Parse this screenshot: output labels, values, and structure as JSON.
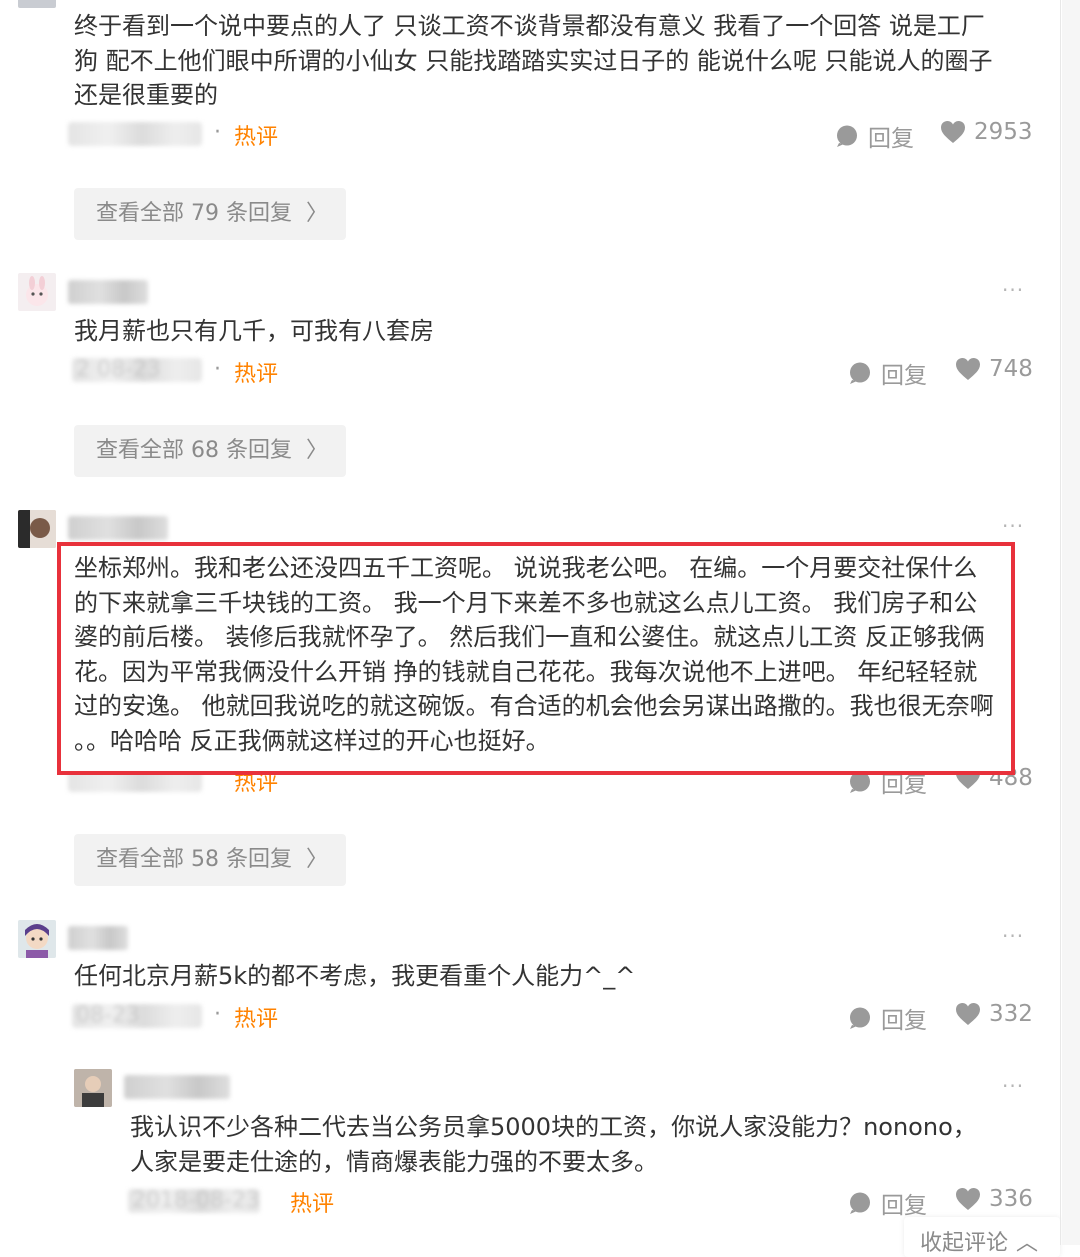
{
  "comments": [
    {
      "lines": [
        "终于看到一个说中要点的人了 只谈工资不谈背景都没有意义 我看了一个回答 说是工厂",
        "狗 配不上他们眼中所谓的小仙女 只能找踏踏实实过日子的 能说什么呢 只能说人的圈子",
        "还是很重要的"
      ],
      "meta_dot": "·",
      "hot_label": "热评",
      "reply_label": "回复",
      "likes": "2953",
      "view_all": "查看全部 79 条回复"
    },
    {
      "lines": [
        "我月薪也只有几千，可我有八套房"
      ],
      "date_partial": "2  08-23",
      "meta_dot": "·",
      "hot_label": "热评",
      "reply_label": "回复",
      "likes": "748",
      "view_all": "查看全部 68 条回复",
      "more": "···"
    },
    {
      "lines": [
        "坐标郑州。我和老公还没四五千工资呢。 说说我老公吧。 在编。一个月要交社保什么",
        "的下来就拿三千块钱的工资。 我一个月下来差不多也就这么点儿工资。 我们房子和公",
        "婆的前后楼。 装修后我就怀孕了。 然后我们一直和公婆住。就这点儿工资 反正够我俩",
        "花。因为平常我俩没什么开销 挣的钱就自己花花。我每次说他不上进吧。 年纪轻轻就",
        "过的安逸。 他就回我说吃的就这碗饭。有合适的机会他会另谋出路撒的。我也很无奈啊",
        "。。哈哈哈 反正我俩就这样过的开心也挺好。"
      ],
      "hot_label": "热评",
      "reply_label": "回复",
      "likes": "488",
      "view_all": "查看全部 58 条回复",
      "more": "···"
    },
    {
      "lines": [
        "任何北京月薪5k的都不考虑，我更看重个人能力^_^"
      ],
      "date_partial": "08-23",
      "meta_dot": "·",
      "hot_label": "热评",
      "reply_label": "回复",
      "likes": "332",
      "more": "···"
    },
    {
      "lines": [
        "我认识不少各种二代去当公务员拿5000块的工资，你说人家没能力？nonono，",
        "人家是要走仕途的，情商爆表能力强的不要太多。"
      ],
      "date_partial": "2018-08-23",
      "hot_label": "热评",
      "reply_label": "回复",
      "likes": "336",
      "more": "···"
    }
  ],
  "collapse_label": "收起评论",
  "colors": {
    "accent": "#ff8200",
    "highlight": "#e8313b",
    "text": "#333333",
    "muted": "#9a9a9a"
  }
}
